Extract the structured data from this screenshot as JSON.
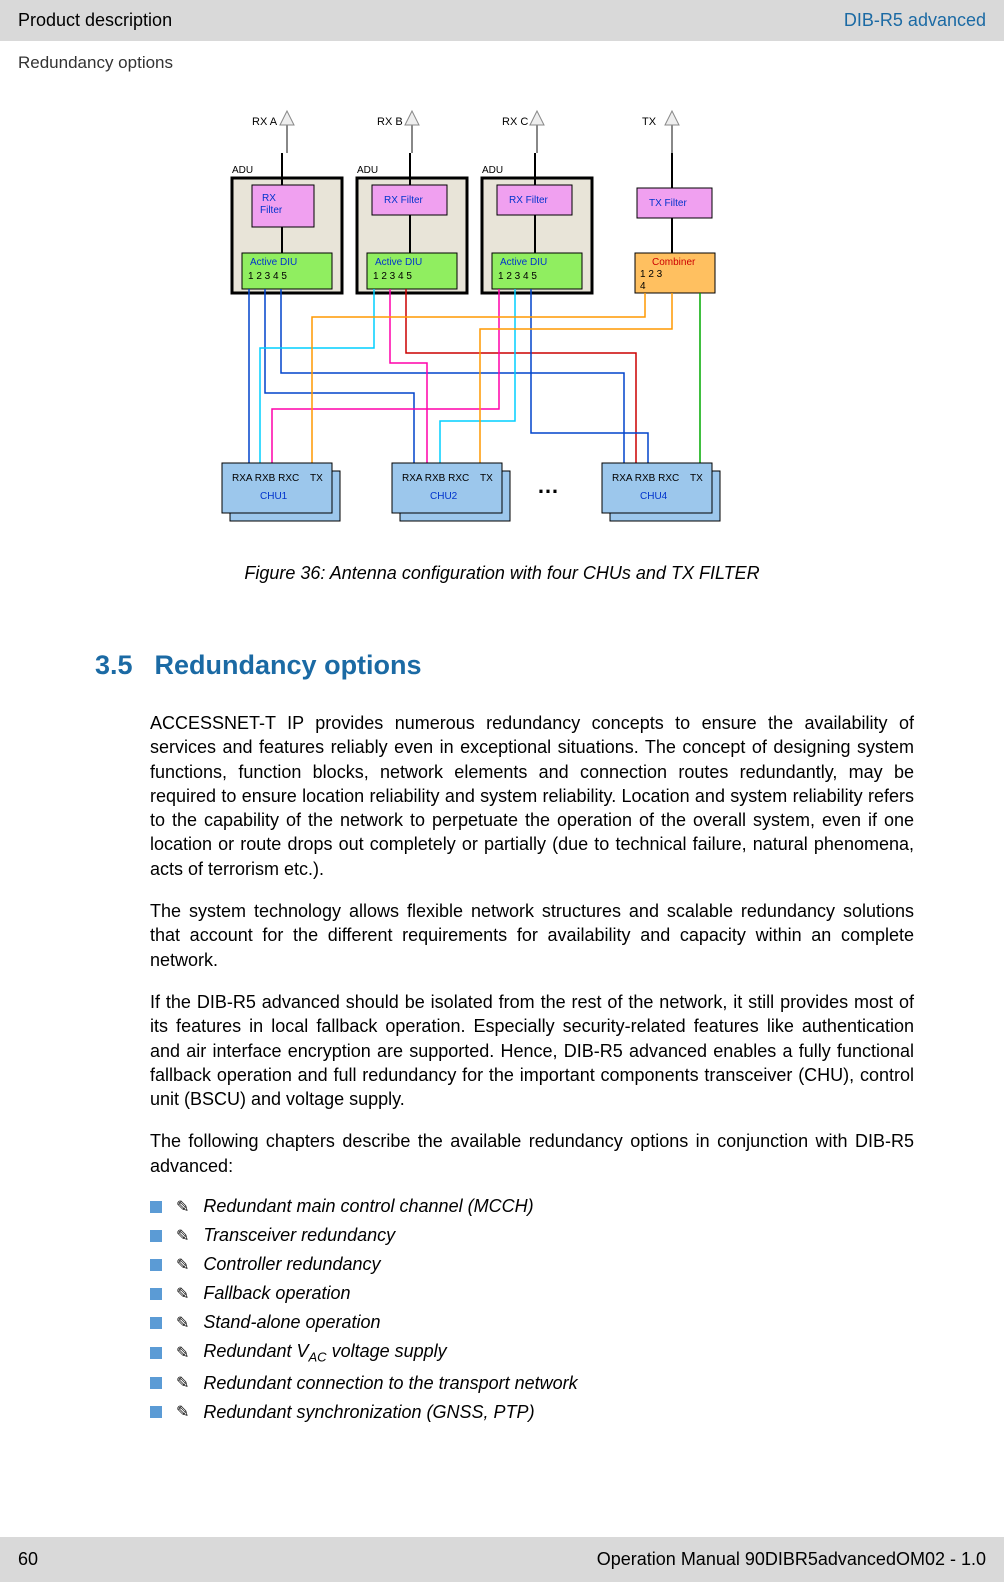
{
  "header": {
    "left": "Product description",
    "right": "DIB-R5 advanced"
  },
  "subheader": "Redundancy options",
  "figure": {
    "caption": "Figure 36: Antenna configuration with four CHUs and TX FILTER",
    "antennas": [
      "RX A",
      "RX B",
      "RX C",
      "TX"
    ],
    "adu_label": "ADU",
    "rx_filter": "RX Filter",
    "rx_filter_wrap": "RX\nFilter",
    "tx_filter": "TX Filter",
    "active_diu": "Active DIU",
    "diu_ports": "1   2  3  4  5",
    "combiner": "Combiner",
    "combiner_ports_top": "1    2    3",
    "combiner_ports_bot": "4",
    "chu_rx_labels": "RXA  RXB  RXC",
    "chu_tx_label": "TX",
    "chu1": "CHU1",
    "chu2": "CHU2",
    "chu4": "CHU4",
    "ellipsis": "…"
  },
  "section": {
    "number": "3.5",
    "title": "Redundancy options"
  },
  "paragraphs": {
    "p1": "ACCESSNET-T IP provides numerous redundancy concepts to ensure the availability of services and features reliably even in exceptional situations. The concept of designing system functions, function blocks, network elements and connection routes redundantly, may be required to ensure location reliability and system reliability. Location and system reliability refers to the capability of the network to perpetuate the operation of the overall system, even if one location or route drops out completely or partially (due to technical failure, natural phenomena, acts of terrorism etc.).",
    "p2": "The system technology allows flexible network structures and scalable redundancy solutions that account for the different requirements for availability and capacity within an complete network.",
    "p3": "If the DIB-R5 advanced should be isolated from the rest of the network, it still provides most of its features in local fallback operation. Especially security-related features like authentication and air interface encryption are supported. Hence, DIB-R5 advanced enables a fully functional fallback operation and full redundancy for the important components transceiver (CHU), control unit (BSCU) and voltage supply.",
    "p4": "The following chapters describe the available redundancy options in conjunction with DIB-R5 advanced:"
  },
  "list": {
    "i1": "Redundant main control channel (MCCH)",
    "i2": "Transceiver redundancy",
    "i3": "Controller redundancy",
    "i4": "Fallback operation",
    "i5": "Stand-alone operation",
    "i6a": "Redundant V",
    "i6sub": "AC",
    "i6b": " voltage supply",
    "i7": "Redundant connection to the transport network",
    "i8": "Redundant synchronization (GNSS, PTP)",
    "link_icon": "✎"
  },
  "footer": {
    "page": "60",
    "doc": "Operation Manual 90DIBR5advancedOM02 - 1.0"
  }
}
